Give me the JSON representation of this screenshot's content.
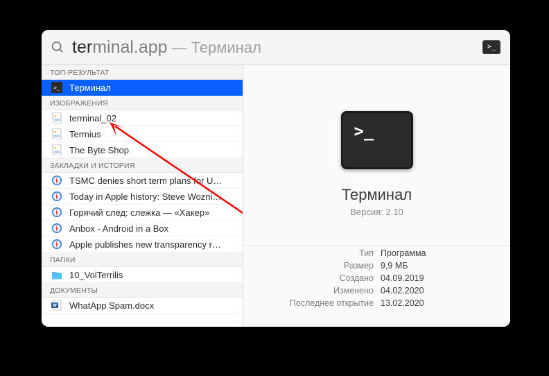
{
  "search": {
    "typed_bold": "ter",
    "typed_rest": "minal.app",
    "mdash": "—",
    "match_name": "Терминал"
  },
  "sections": {
    "top": "ТОП-РЕЗУЛЬТАТ",
    "images": "ИЗОБРАЖЕНИЯ",
    "bookmarks": "ЗАКЛАДКИ И ИСТОРИЯ",
    "folders": "ПАПКИ",
    "documents": "ДОКУМЕНТЫ"
  },
  "results": {
    "top": [
      {
        "icon": "terminal",
        "label": "Терминал",
        "selected": true
      }
    ],
    "images": [
      {
        "icon": "image",
        "label": "terminal_02"
      },
      {
        "icon": "image",
        "label": "Termius"
      },
      {
        "icon": "image",
        "label": "The Byte Shop"
      }
    ],
    "bookmarks": [
      {
        "icon": "safari",
        "label": "TSMC denies short term plans for U…"
      },
      {
        "icon": "safari",
        "label": "Today in Apple history: Steve Wozni…"
      },
      {
        "icon": "safari",
        "label": "Горячий след: слежка — «Хакер»"
      },
      {
        "icon": "safari",
        "label": "Anbox - Android in a Box"
      },
      {
        "icon": "safari",
        "label": "Apple publishes new transparency r…"
      }
    ],
    "folders": [
      {
        "icon": "folder",
        "label": "10_VolTerrilis"
      }
    ],
    "documents": [
      {
        "icon": "docx",
        "label": "WhatApp Spam.docx"
      }
    ]
  },
  "preview": {
    "title": "Терминал",
    "version_line": "Версия: 2.10",
    "meta": [
      {
        "k": "Тип",
        "v": "Программа"
      },
      {
        "k": "Размер",
        "v": "9,9 МБ"
      },
      {
        "k": "Создано",
        "v": "04.09.2019"
      },
      {
        "k": "Изменено",
        "v": "04.02.2020"
      },
      {
        "k": "Последнее открытие",
        "v": "13.02.2020"
      }
    ]
  },
  "annotation": {
    "arrow_color": "#ff0000"
  }
}
